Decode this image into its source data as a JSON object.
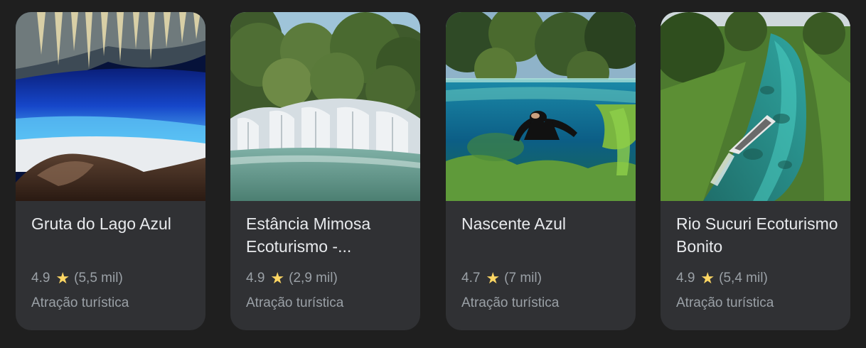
{
  "colors": {
    "page_background": "#1f1f1f",
    "card_background": "#303134",
    "title_text": "#e8eaed",
    "secondary_text": "#9aa0a6",
    "star": "#fdd663"
  },
  "places": [
    {
      "title": "Gruta do Lago Azul",
      "rating": "4.9",
      "reviews": "(5,5 mil)",
      "category": "Atração turística",
      "star_icon": "★"
    },
    {
      "title": "Estância Mimosa Ecoturismo -...",
      "rating": "4.9",
      "reviews": "(2,9 mil)",
      "category": "Atração turística",
      "star_icon": "★"
    },
    {
      "title": "Nascente Azul",
      "rating": "4.7",
      "reviews": "(7 mil)",
      "category": "Atração turística",
      "star_icon": "★"
    },
    {
      "title": "Rio Sucuri Ecoturismo Bonito",
      "rating": "4.9",
      "reviews": "(5,4 mil)",
      "category": "Atração turística",
      "star_icon": "★"
    }
  ]
}
